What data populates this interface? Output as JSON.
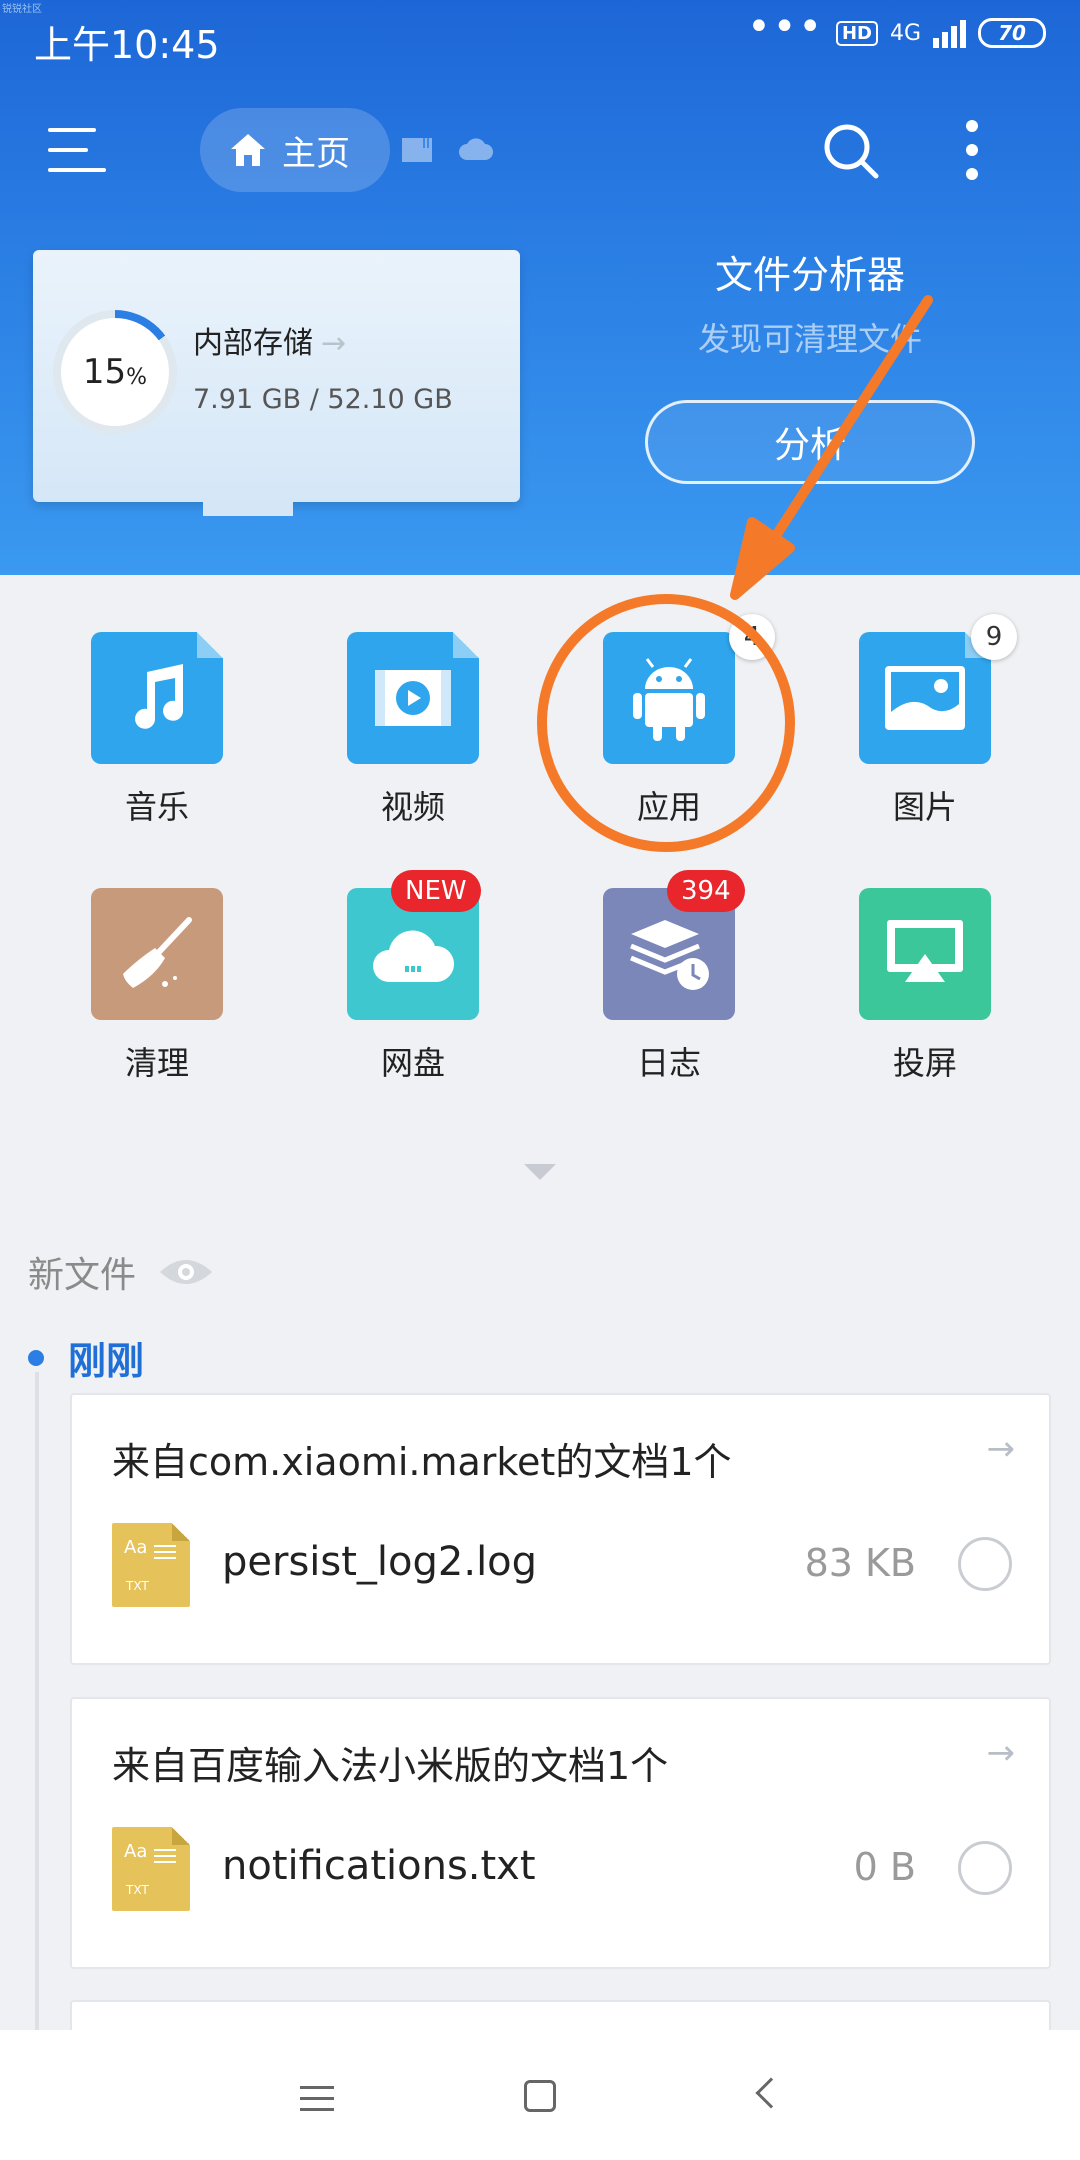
{
  "status_bar": {
    "time": "上午10:45",
    "network": "4G",
    "hd": "HD",
    "battery": "70",
    "corner_label": "锐锐社区"
  },
  "toolbar": {
    "home_label": "主页",
    "icons": [
      "menu-icon",
      "sd-card-icon",
      "cloud-icon",
      "search-icon",
      "more-icon"
    ]
  },
  "storage": {
    "percent": "15",
    "percent_sign": "%",
    "percent_value": 0.15,
    "title": "内部存储",
    "arrow": "→",
    "usage": "7.91 GB / 52.10 GB"
  },
  "analyzer": {
    "title": "文件分析器",
    "subtitle": "发现可清理文件",
    "button": "分析"
  },
  "categories": [
    {
      "label": "音乐",
      "icon": "music-icon",
      "color": "#2ea5ec"
    },
    {
      "label": "视频",
      "icon": "video-icon",
      "color": "#2ea5ec"
    },
    {
      "label": "应用",
      "icon": "android-icon",
      "color": "#2ea5ec",
      "badge": "4"
    },
    {
      "label": "图片",
      "icon": "image-icon",
      "color": "#2ea5ec",
      "badge": "9"
    },
    {
      "label": "清理",
      "icon": "broom-icon",
      "color": "#c89a7c"
    },
    {
      "label": "网盘",
      "icon": "cloud-drive-icon",
      "color": "#3fc7cf",
      "badge": "NEW"
    },
    {
      "label": "日志",
      "icon": "log-icon",
      "color": "#7b86b9",
      "badge": "394"
    },
    {
      "label": "投屏",
      "icon": "cast-icon",
      "color": "#3bc79a"
    }
  ],
  "new_files": {
    "label": "新文件",
    "group_label": "刚刚",
    "cards": [
      {
        "title": "来自com.xiaomi.market的文档1个",
        "file_name": "persist_log2.log",
        "file_size": "83 KB",
        "icon_aa": "Aa",
        "icon_type": "TXT"
      },
      {
        "title": "来自百度输入法小米版的文档1个",
        "file_name": "notifications.txt",
        "file_size": "0 B",
        "icon_aa": "Aa",
        "icon_type": "TXT"
      }
    ],
    "card_arrow": "→"
  },
  "accent_colors": {
    "header_blue": "#2b7fe4",
    "annotation_orange": "#f47a2a",
    "badge_red": "#e8262b"
  }
}
